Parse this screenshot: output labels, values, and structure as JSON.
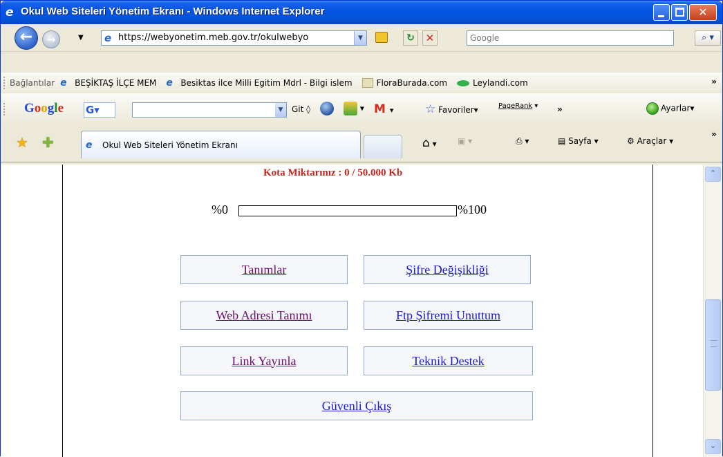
{
  "window": {
    "title": "Okul Web Siteleri Yönetim Ekranı - Windows Internet Explorer"
  },
  "address_bar": {
    "url": "https://webyonetim.meb.gov.tr/okulwebyo",
    "search_placeholder": "Google"
  },
  "links_bar": {
    "label": "Bağlantılar",
    "items": [
      {
        "label": "BEŞİKTAŞ İLÇE MEM",
        "icon": "ie-page-icon"
      },
      {
        "label": "Besiktas ilce Milli Egitim Mdrl - Bilgi islem",
        "icon": "ie-page-icon"
      },
      {
        "label": "FloraBurada.com",
        "icon": "flora-favicon"
      },
      {
        "label": "Leylandi.com",
        "icon": "leaf-favicon"
      }
    ],
    "overflow": "»"
  },
  "google_toolbar": {
    "logo": "Google",
    "go_label": "Git",
    "favorites_label": "Favoriler",
    "pagerank_label": "PageRank",
    "overflow": "»",
    "settings_label": "Ayarlar"
  },
  "tabs": {
    "active": "Okul Web Siteleri Yönetim Ekranı"
  },
  "command_bar": {
    "page_label": "Sayfa",
    "tools_label": "Araçlar",
    "overflow": "»"
  },
  "content": {
    "quota_text": "Kota Miktarınız : 0 / 50.000 Kb",
    "progress": {
      "min_label": "%0",
      "max_label": "%100",
      "fraction": 0
    },
    "menu": {
      "definitions": "Tanımlar",
      "password_change": "Şifre Değişikliği",
      "web_address": "Web Adresi Tanımı",
      "ftp_forgot": "Ftp Şifremi Unuttum",
      "publish_link": "Link Yayınla",
      "tech_support": "Teknik Destek",
      "secure_exit": "Güvenli Çıkış"
    }
  },
  "colors": {
    "quota": "#c1271d",
    "visited_link": "#6b0f6f",
    "link": "#1c1ad6"
  }
}
